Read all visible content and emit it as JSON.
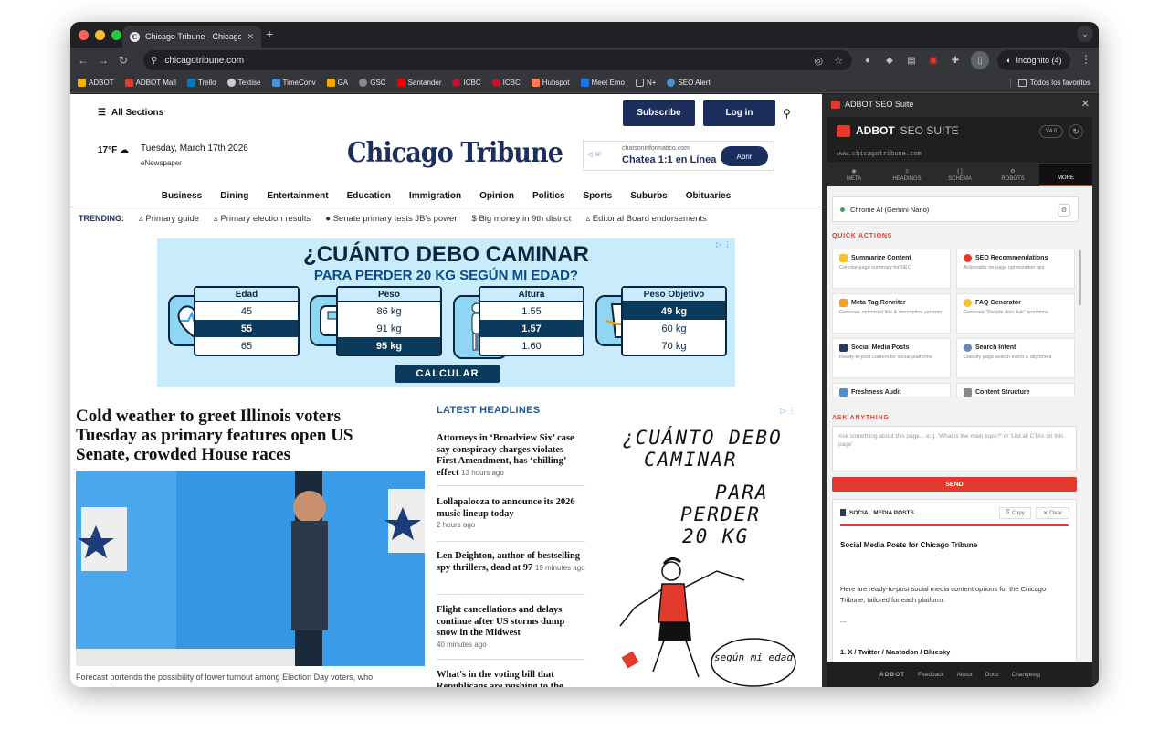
{
  "browser": {
    "tab_title": "Chicago Tribune - Chicago N",
    "url": "chicagotribune.com",
    "incognito_label": "Incógnito (4)",
    "bookmarks": [
      "ADBOT",
      "ADBOT Mail",
      "Trello",
      "Textise",
      "TimeConv",
      "GA",
      "GSC",
      "Santander",
      "ICBC",
      "ICBC",
      "Hubspot",
      "Meet Emo",
      "N+",
      "SEO Alert"
    ],
    "bookmarks_right": "Todos los favoritos"
  },
  "site": {
    "all_sections": "All Sections",
    "subscribe": "Subscribe",
    "login": "Log in",
    "temperature": "17°F",
    "date": "Tuesday, March 17th 2026",
    "enewspaper": "eNewspaper",
    "logo": "Chicago Tribune",
    "chat_ad": {
      "site": "chatsoninformatico.com",
      "text": "Chatea 1:1 en Línea",
      "button": "Abrir"
    },
    "nav": [
      "Business",
      "Dining",
      "Entertainment",
      "Education",
      "Immigration",
      "Opinion",
      "Politics",
      "Sports",
      "Suburbs",
      "Obituaries"
    ],
    "trending_label": "TRENDING:",
    "trending": [
      "Primary guide",
      "Primary election results",
      "Senate primary tests JB's power",
      "Big money in 9th district",
      "Editorial Board endorsements"
    ],
    "ad": {
      "title": "¿CUÁNTO DEBO CAMINAR",
      "subtitle": "PARA PERDER 20 KG SEGÚN MI EDAD?",
      "cards": [
        {
          "title": "Edad",
          "values": [
            "45",
            "55",
            "65"
          ],
          "highlight": 1
        },
        {
          "title": "Peso",
          "values": [
            "86 kg",
            "91 kg",
            "95 kg"
          ],
          "highlight": 2
        },
        {
          "title": "Altura",
          "values": [
            "1.55",
            "1.57",
            "1.60"
          ],
          "highlight": 1
        },
        {
          "title": "Peso Objetivo",
          "values": [
            "49 kg",
            "60 kg",
            "70 kg"
          ],
          "highlight": 0
        }
      ],
      "button": "CALCULAR"
    },
    "main_headline": "Cold weather to greet Illinois voters Tuesday as primary features open US Senate, crowded House races",
    "caption": "Forecast portends the possibility of lower turnout among Election Day voters, who",
    "latest_label": "LATEST HEADLINES",
    "latest": [
      {
        "title": "Attorneys in ‘Broadview Six’ case say conspiracy charges violates First Amendment, has ‘chilling’ effect",
        "time": "13 hours ago"
      },
      {
        "title": "Lollapalooza to announce its 2026 music lineup today",
        "time": "2 hours ago"
      },
      {
        "title": "Len Deighton, author of bestselling spy thrillers, dead at 97",
        "time": "19 minutes ago"
      },
      {
        "title": "Flight cancellations and delays continue after US storms dump snow in the Midwest",
        "time": "40 minutes ago"
      },
      {
        "title": "What's in the voting bill that Republicans are pushing to the",
        "time": ""
      }
    ],
    "ad2": {
      "l1": "¿CUÁNTO DEBO",
      "l2": "CAMINAR",
      "l3": "PARA",
      "l4": "PERDER",
      "l5": "20 KG",
      "bubble": "según mi edad"
    }
  },
  "sidebar": {
    "header": "ADBOT SEO Suite",
    "brand_a": "ADBOT",
    "brand_b": "SEO SUITE",
    "version": "V4.0",
    "url": "www.chicagotribune.com",
    "tabs": [
      {
        "label": "META",
        "icon": "◉"
      },
      {
        "label": "HEADINGS",
        "icon": "≡"
      },
      {
        "label": "SCHEMA",
        "icon": "{ }"
      },
      {
        "label": "ROBOTS",
        "icon": "⚙"
      },
      {
        "label": "MORE",
        "icon": "···"
      }
    ],
    "ai_model": "Chrome AI (Gemini Nano)",
    "quick_actions_label": "QUICK ACTIONS",
    "quick_actions": [
      {
        "title": "Summarize Content",
        "desc": "Concise page summary for SEO"
      },
      {
        "title": "SEO Recommendations",
        "desc": "Actionable on-page optimization tips"
      },
      {
        "title": "Meta Tag Rewriter",
        "desc": "Generate optimized title & description variants"
      },
      {
        "title": "FAQ Generator",
        "desc": "Generate \"People Also Ask\" questions"
      },
      {
        "title": "Social Media Posts",
        "desc": "Ready-to-post content for social platforms"
      },
      {
        "title": "Search Intent",
        "desc": "Classify page search intent & alignment"
      },
      {
        "title": "Freshness Audit",
        "desc": ""
      },
      {
        "title": "Content Structure",
        "desc": ""
      }
    ],
    "ask_label": "ASK ANYTHING",
    "ask_placeholder": "Ask something about this page... e.g. 'What is the main topic?' or 'List all CTAs on this page'",
    "send": "SEND",
    "result_header": "SOCIAL MEDIA POSTS",
    "copy": "Copy",
    "clear": "Clear",
    "result_title": "Social Media Posts for Chicago Tribune",
    "result_text": "Here are ready-to-post social media content options for the Chicago Tribune, tailored for each platform:",
    "result_dash": "---",
    "result_item": "1. X / Twitter / Mastodon / Bluesky",
    "footer": [
      "ADBOT",
      "Feedback",
      "About",
      "Docs",
      "Changelog"
    ]
  }
}
